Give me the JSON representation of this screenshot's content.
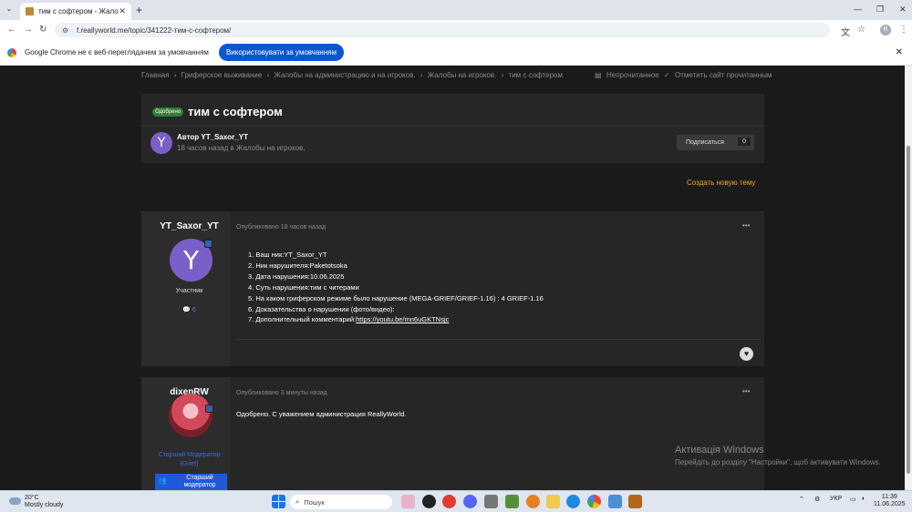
{
  "browser": {
    "tab_title": "тим с софтером - Жалобы на ...",
    "url": "f.reallyworld.me/topic/341222-тим-с-софтером/",
    "profile_initial": "R"
  },
  "infobar": {
    "message": "Google Chrome не є веб-переглядачем за умовчанням",
    "button": "Використовувати за умовчанням"
  },
  "breadcrumbs": [
    "Главная",
    "›",
    "Гриферское выживание",
    "›",
    "Жалобы на администрацию и на игроков.",
    "›",
    "Жалобы на игроков.",
    "›",
    "тим с софтером"
  ],
  "crumb_actions": {
    "unread": "Непрочитанное",
    "mark_read": "Отметить сайт прочитанным"
  },
  "topic": {
    "badge": "Одобрено",
    "title": "тим с софтером",
    "author_initial": "Y",
    "author_line": "Автор YT_Saxor_YT",
    "author_sub": "18 часов назад в Жалобы на игроков.",
    "follow_label": "Подписаться",
    "follow_count": "0"
  },
  "new_topic": "Создать новую тему",
  "posts": [
    {
      "username": "YT_Saxor_YT",
      "initial": "Y",
      "role": "Участник",
      "post_count": "💬 6",
      "meta": "Опубликовано 18 часов назад",
      "lines": [
        "1. Ваш ник:YT_Saxor_YT",
        "2. Ник нарушителя:Paketotsoka",
        "3. Дата нарушения:10.06.2025",
        "4. Суть нарушения:тим с читерами",
        "5. На каком гриферском режиме было нарушение (MEGA-GRIEF/GRIEF-1.16) :  4 GRIEF-1.16",
        "6. Доказательства о нарушении (фото/видео):"
      ],
      "line7_prefix": "7. Дополнительный комментарий:",
      "line7_link": "https://youtu.be/mn6uGKTNsjc"
    },
    {
      "username": "dixenRW",
      "role_line1": "Старший Модератор",
      "role_line2": "(Grief)",
      "badge_line1": "Старший",
      "badge_line2": "модератор",
      "meta": "Опубликовано 3 минуты назад",
      "text": "Одобрено. С уважением администрация ReallyWorld."
    }
  ],
  "watermark": {
    "title": "Активація Windows",
    "subtitle": "Перейдіть до розділу \"Настройки\", щоб активувати Windows."
  },
  "taskbar": {
    "temp": "20°C",
    "weather": "Mostly cloudy",
    "search_placeholder": "Пошук",
    "lang": "УКР",
    "time": "11:39",
    "date": "11.06.2025"
  }
}
